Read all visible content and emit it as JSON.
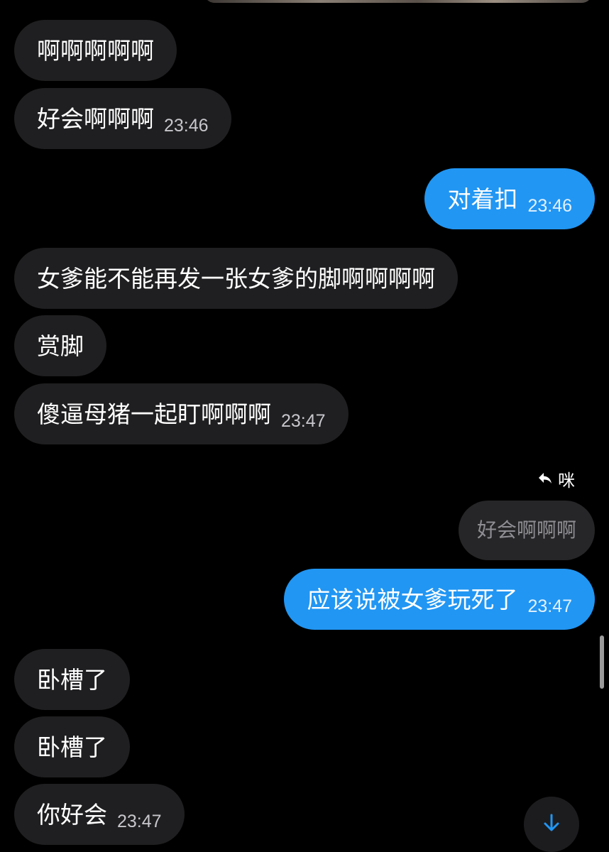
{
  "messages": [
    {
      "direction": "in",
      "text": "啊啊啊啊啊",
      "time": ""
    },
    {
      "direction": "in",
      "text": "好会啊啊啊",
      "time": "23:46"
    },
    {
      "direction": "out",
      "text": "对着扣",
      "time": "23:46"
    },
    {
      "direction": "in",
      "text": "女爹能不能再发一张女爹的脚啊啊啊啊",
      "time": ""
    },
    {
      "direction": "in",
      "text": "赏脚",
      "time": ""
    },
    {
      "direction": "in",
      "text": "傻逼母猪一起盯啊啊啊",
      "time": "23:47"
    },
    {
      "direction": "out",
      "text": "应该说被女爹玩死了",
      "time": "23:47"
    },
    {
      "direction": "in",
      "text": "卧槽了",
      "time": ""
    },
    {
      "direction": "in",
      "text": "卧槽了",
      "time": ""
    },
    {
      "direction": "in",
      "text": "你好会",
      "time": "23:47"
    }
  ],
  "reply": {
    "sender": "咪",
    "quoted_text": "好会啊啊啊"
  },
  "icons": {
    "reply": "reply-arrow-icon",
    "scroll_down": "arrow-down-icon"
  },
  "colors": {
    "background": "#000000",
    "incoming_bubble": "#1f1f21",
    "outgoing_bubble": "#2196f3",
    "quote_bubble": "#262628",
    "accent": "#2196f3"
  }
}
